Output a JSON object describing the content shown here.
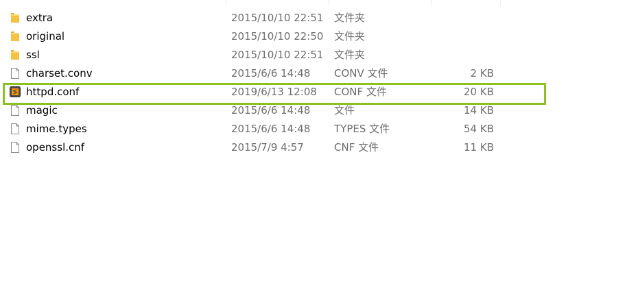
{
  "files": [
    {
      "name": "extra",
      "date": "2015/10/10 22:51",
      "type": "文件夹",
      "size": "",
      "icon": "folder-icon"
    },
    {
      "name": "original",
      "date": "2015/10/10 22:50",
      "type": "文件夹",
      "size": "",
      "icon": "folder-icon"
    },
    {
      "name": "ssl",
      "date": "2015/10/10 22:51",
      "type": "文件夹",
      "size": "",
      "icon": "folder-icon"
    },
    {
      "name": "charset.conv",
      "date": "2015/6/6 14:48",
      "type": "CONV 文件",
      "size": "2 KB",
      "icon": "file-icon"
    },
    {
      "name": "httpd.conf",
      "date": "2019/6/13 12:08",
      "type": "CONF 文件",
      "size": "20 KB",
      "icon": "sublime-text-file-icon"
    },
    {
      "name": "magic",
      "date": "2015/6/6 14:48",
      "type": "文件",
      "size": "14 KB",
      "icon": "file-icon"
    },
    {
      "name": "mime.types",
      "date": "2015/6/6 14:48",
      "type": "TYPES 文件",
      "size": "54 KB",
      "icon": "file-icon"
    },
    {
      "name": "openssl.cnf",
      "date": "2015/7/9 4:57",
      "type": "CNF 文件",
      "size": "11 KB",
      "icon": "file-icon"
    }
  ],
  "highlight_color": "#8cc11f",
  "folder_color": "#f5c243",
  "secondary_text_color": "#6d6d6d"
}
